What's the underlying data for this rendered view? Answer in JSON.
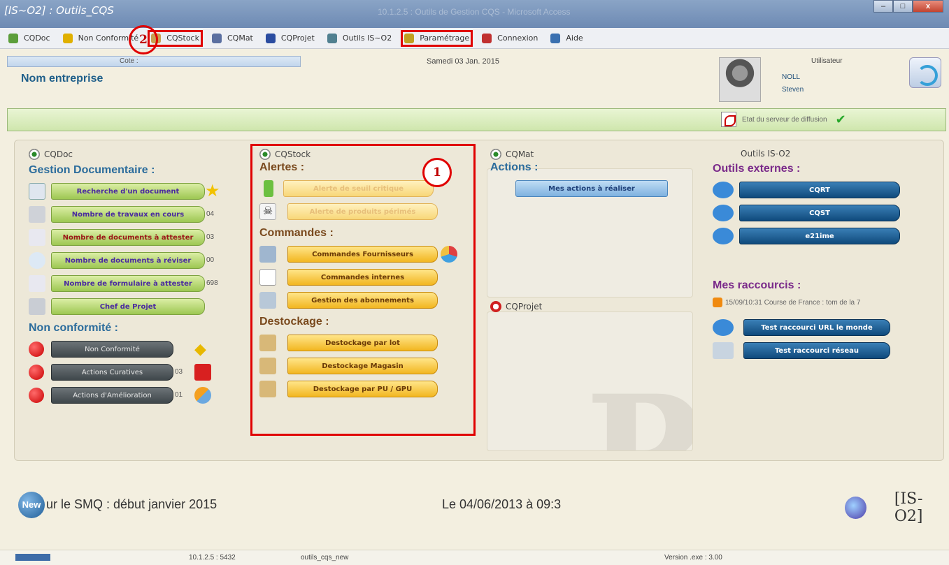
{
  "window": {
    "title": "[IS~O2] : Outils_CQS",
    "subtitle": "10.1.2.5 : Outils de Gestion CQS - Microsoft Access",
    "minimize": "–",
    "maximize": "□",
    "close": "x"
  },
  "menu": [
    {
      "label": "CQDoc",
      "icon": "gear-icon",
      "color": "#5c9e3a"
    },
    {
      "label": "Non Conformité",
      "icon": "arrow-down-icon",
      "color": "#e0b000"
    },
    {
      "label": "CQStock",
      "icon": "box-icon",
      "color": "#c8a050"
    },
    {
      "label": "CQMat",
      "icon": "puzzle-icon",
      "color": "#5a6fa0"
    },
    {
      "label": "CQProjet",
      "icon": "p-icon",
      "color": "#2a4ca0"
    },
    {
      "label": "Outils IS~O2",
      "icon": "tools-icon",
      "color": "#508090"
    },
    {
      "label": "Paramétrage",
      "icon": "pencil-icon",
      "color": "#c0a020"
    },
    {
      "label": "Connexion",
      "icon": "book-icon",
      "color": "#c03030"
    },
    {
      "label": "Aide",
      "icon": "people-icon",
      "color": "#3a70b0"
    }
  ],
  "header": {
    "search_label": "Cote :",
    "company": "Nom entreprise",
    "date": "Samedi 03 Jan. 2015",
    "user_label": "Utilisateur",
    "user_last": "NOLL",
    "user_first": "Steven"
  },
  "server_status": "Etat du serveur de diffusion",
  "cqdoc": {
    "title": "CQDoc",
    "section": "Gestion Documentaire :",
    "buttons": [
      {
        "label": "Recherche d'un document",
        "count": ""
      },
      {
        "label": "Nombre de travaux en cours",
        "count": "04"
      },
      {
        "label": "Nombre de documents à attester",
        "count": "03"
      },
      {
        "label": "Nombre de documents à réviser",
        "count": "00"
      },
      {
        "label": "Nombre de formulaire à attester",
        "count": "698"
      },
      {
        "label": "Chef de Projet",
        "count": ""
      }
    ],
    "nc_section": "Non conformité :",
    "nc_buttons": [
      {
        "label": "Non Conformité",
        "count": ""
      },
      {
        "label": "Actions Curatives",
        "count": "03"
      },
      {
        "label": "Actions d'Amélioration",
        "count": "01"
      }
    ]
  },
  "cqstock": {
    "title": "CQStock",
    "alerts": "Alertes :",
    "alert_buttons": [
      "Alerte de seuil critique",
      "Alerte de produits périmés"
    ],
    "orders": "Commandes :",
    "order_buttons": [
      "Commandes Fournisseurs",
      "Commandes internes",
      "Gestion des abonnements"
    ],
    "destock": "Destockage :",
    "destock_buttons": [
      "Destockage par lot",
      "Destockage Magasin",
      "Destockage par PU / GPU"
    ]
  },
  "cqmat": {
    "title": "CQMat",
    "section": "Actions :",
    "button": "Mes actions à réaliser"
  },
  "cqprojet": {
    "title": "CQProjet"
  },
  "outils": {
    "title": "Outils IS-O2",
    "ext": "Outils externes :",
    "ext_buttons": [
      "CQRT",
      "CQST",
      "e21ime"
    ],
    "shortcuts": "Mes raccourcis :",
    "rss": "15/09/10:31    Course de France : tom de la 7",
    "short_buttons": [
      "Test raccourci URL le monde",
      "Test raccourci réseau"
    ]
  },
  "annotations": {
    "one": "1",
    "two": "2"
  },
  "footer": {
    "new": "New",
    "news": "ur le SMQ : début janvier 2015",
    "stamp": "Le 04/06/2013 à 09:3",
    "logo": "[IS-O2]"
  },
  "statusbar": {
    "ip": "10.1.2.5 : 5432",
    "db": "outils_cqs_new",
    "version": "Version .exe : 3.00"
  }
}
